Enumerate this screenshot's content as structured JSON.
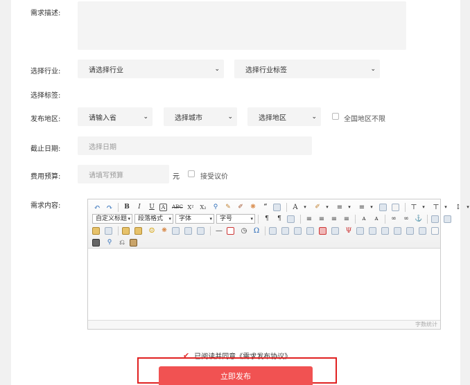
{
  "form": {
    "desc_label": "需求描述:",
    "industry_label": "选择行业:",
    "industry_select": "请选择行业",
    "industry_tag_select": "选择行业标签",
    "tags_label": "选择标签:",
    "region_label": "发布地区:",
    "province_select": "请输入省",
    "city_select": "选择城市",
    "district_select": "选择地区",
    "nationwide_label": "全国地区不限",
    "deadline_label": "截止日期:",
    "deadline_placeholder": "选择日期",
    "budget_label": "费用预算:",
    "budget_placeholder": "请填写预算",
    "budget_unit": "元",
    "negotiable_label": "接受议价",
    "content_label": "需求内容:"
  },
  "editor": {
    "custom_title": "自定义标题",
    "paragraph_format": "段落格式",
    "font_family": "字体",
    "font_size": "字号",
    "word_count": "字数统计",
    "row1_text_buttons": [
      "B",
      "I",
      "U",
      "A",
      "ABC",
      "X²",
      "X₂"
    ],
    "font_color_label": "A"
  },
  "agreement": {
    "text": "已阅读并同意《需求发布协议》",
    "checked": true
  },
  "submit_label": "立即发布",
  "colors": {
    "accent": "#f15252",
    "highlight": "#e02020"
  }
}
